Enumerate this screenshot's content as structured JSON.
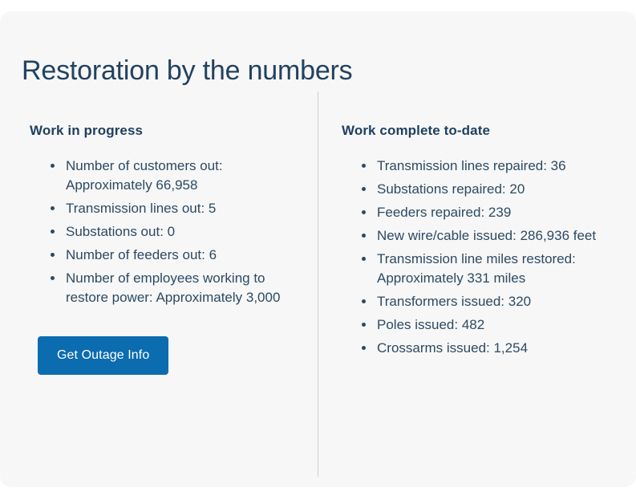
{
  "card": {
    "title": "Restoration by the numbers",
    "background_color": "#f7f7f7",
    "title_color": "#22425f"
  },
  "columns": {
    "left": {
      "heading": "Work in progress",
      "items": [
        "Number of customers out: Approximately 66,958",
        "Transmission lines out: 5",
        "Substations out: 0",
        "Number of feeders out: 6",
        "Number of employees working to restore power: Approximately 3,000"
      ],
      "cta": {
        "label": "Get Outage Info",
        "color": "#0b6cb0",
        "text_color": "#ffffff"
      }
    },
    "right": {
      "heading": "Work complete to-date",
      "items": [
        "Transmission lines repaired: 36",
        "Substations repaired: 20",
        "Feeders repaired: 239",
        "New wire/cable issued: 286,936 feet",
        "Transmission line miles restored: Approximately 331 miles",
        "Transformers issued: 320",
        "Poles issued: 482",
        "Crossarms issued: 1,254"
      ]
    }
  }
}
